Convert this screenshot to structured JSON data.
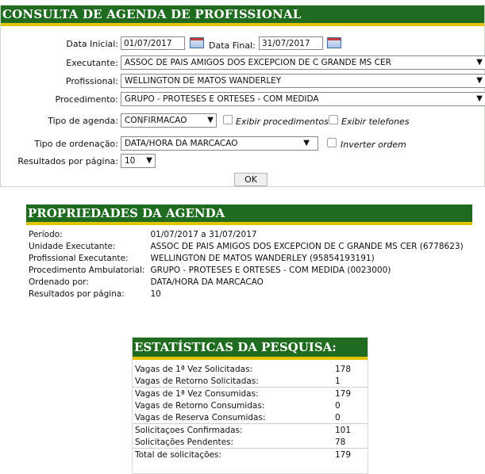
{
  "search": {
    "title": "CONSULTA DE AGENDA DE PROFISSIONAL",
    "data_inicial_label": "Data Inicial:",
    "data_inicial_value": "01/07/2017",
    "data_final_label": "Data Final:",
    "data_final_value": "31/07/2017",
    "executante_label": "Executante:",
    "executante_value": "ASSOC DE PAIS AMIGOS DOS EXCEPCION DE C GRANDE MS CER",
    "profissional_label": "Profissional:",
    "profissional_value": "WELLINGTON DE MATOS WANDERLEY",
    "procedimento_label": "Procedimento:",
    "procedimento_value": "GRUPO - PROTESES E ORTESES - COM MEDIDA",
    "tipo_agenda_label": "Tipo de agenda:",
    "tipo_agenda_value": "CONFIRMACAO",
    "exibir_procedimentos_label": "Exibir procedimentos",
    "exibir_telefones_label": "Exibir telefones",
    "tipo_ordenacao_label": "Tipo de ordenação:",
    "tipo_ordenacao_value": "DATA/HORA DA MARCACAO",
    "inverter_ordem_label": "Inverter ordem",
    "resultados_label": "Resultados por página:",
    "resultados_value": "10",
    "ok_label": "OK",
    "arrow": "▼"
  },
  "properties": {
    "title": "PROPRIEDADES DA AGENDA",
    "rows": [
      {
        "key": "Período:",
        "value": "01/07/2017 a 31/07/2017"
      },
      {
        "key": "Unidade Executante:",
        "value": "ASSOC DE PAIS AMIGOS DOS EXCEPCION DE C GRANDE MS CER (6778623)"
      },
      {
        "key": "Profissional Executante:",
        "value": "WELLINGTON DE MATOS WANDERLEY (95854193191)"
      },
      {
        "key": "Procedimento Ambulatorial:",
        "value": "GRUPO - PROTESES E ORTESES - COM MEDIDA (0023000)"
      },
      {
        "key": "Ordenado por:",
        "value": "DATA/HORA DA MARCACAO"
      },
      {
        "key": "Resultados por página:",
        "value": "10"
      }
    ]
  },
  "stats": {
    "title": "ESTATÍSTICAS DA PESQUISA:",
    "rows": [
      {
        "key": "Vagas de 1ª Vez Solicitadas:",
        "value": "178"
      },
      {
        "key": "Vagas de Retorno Solicitadas:",
        "value": "1"
      },
      {
        "key": "Vagas de 1ª Vez Consumidas:",
        "value": "179"
      },
      {
        "key": "Vagas de Retorno Consumidas:",
        "value": "0"
      },
      {
        "key": "Vagas de Reserva Consumidas:",
        "value": "0"
      },
      {
        "key": "Solicitaçoes Confirmadas:",
        "value": "101"
      },
      {
        "key": "Solicitações Pendentes:",
        "value": "78"
      },
      {
        "key": "Total de solicitações:",
        "value": "179"
      }
    ]
  }
}
